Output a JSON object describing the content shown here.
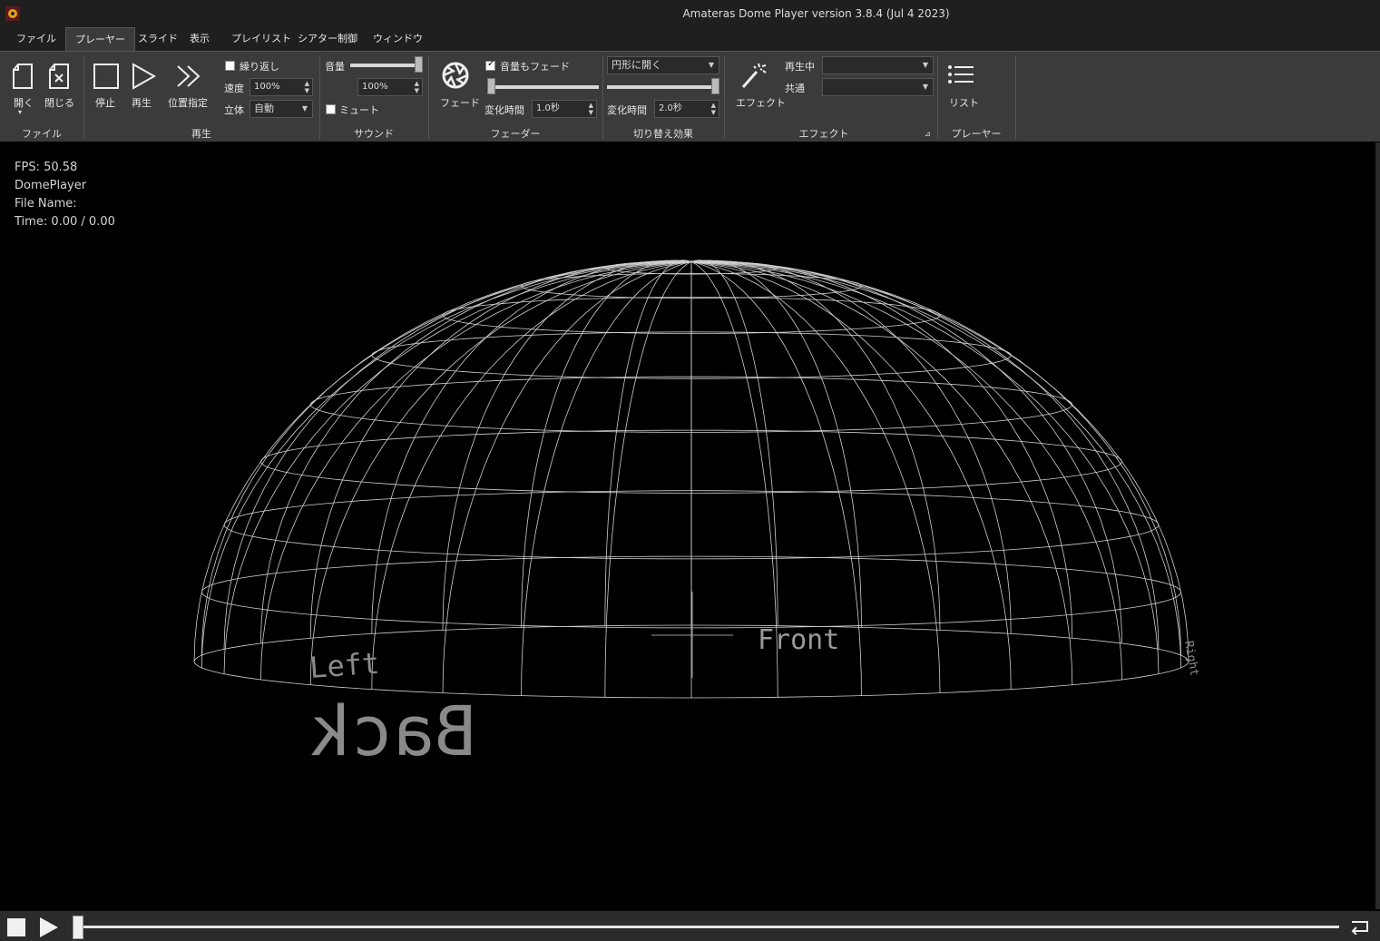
{
  "window": {
    "title": "Amateras Dome Player version 3.8.4 (Jul  4 2023)"
  },
  "tabs": [
    {
      "label": "ファイル",
      "active": false
    },
    {
      "label": "プレーヤー",
      "active": true
    },
    {
      "label": "スライド",
      "active": false
    },
    {
      "label": "表示",
      "active": false
    },
    {
      "label": "プレイリスト",
      "active": false
    },
    {
      "label": "シアター制御",
      "active": false
    },
    {
      "label": "ウィンドウ",
      "active": false
    }
  ],
  "ribbon": {
    "file_group": {
      "label": "ファイル",
      "open_label": "開く",
      "close_label": "閉じる"
    },
    "playback_group": {
      "label": "再生",
      "stop_label": "停止",
      "play_label": "再生",
      "seek_label": "位置指定",
      "loop_label": "繰り返し",
      "loop_checked": false,
      "speed_label": "速度",
      "speed_value": "100%",
      "stereo_label": "立体",
      "stereo_value": "自動"
    },
    "sound_group": {
      "label": "サウンド",
      "volume_label": "音量",
      "volume_value": "100%",
      "volume_level": 1.0,
      "mute_label": "ミュート",
      "mute_checked": false
    },
    "fader_group": {
      "label": "フェーダー",
      "fade_label": "フェード",
      "fade_volume_label": "音量もフェード",
      "fade_volume_checked": true,
      "change_time_label": "変化時間",
      "change_time_value": "1.0秒",
      "fader_level": 0.0
    },
    "transition_group": {
      "label": "切り替え効果",
      "mode_value": "円形に開く",
      "change_time_label": "変化時間",
      "change_time_value": "2.0秒",
      "transition_level": 1.0
    },
    "effect_group": {
      "label": "エフェクト",
      "effect_label": "エフェクト",
      "playing_label": "再生中",
      "playing_value": "",
      "common_label": "共通",
      "common_value": ""
    },
    "player_group": {
      "label": "プレーヤー",
      "list_label": "リスト"
    }
  },
  "overlay": {
    "fps": "FPS: 50.58",
    "app_name": "DomePlayer",
    "file_name": "File Name:",
    "time": "Time: 0.00 / 0.00"
  },
  "dome_labels": {
    "front": "Front",
    "left": "Left",
    "back": "Back",
    "right": "Right"
  },
  "seek": {
    "position": 0.0
  },
  "colors": {
    "titlebar": "#1f1f1f",
    "ribbon": "#3b3b3b",
    "wireframe": "#cfcfcf",
    "label_gray": "#8a8a8a"
  }
}
